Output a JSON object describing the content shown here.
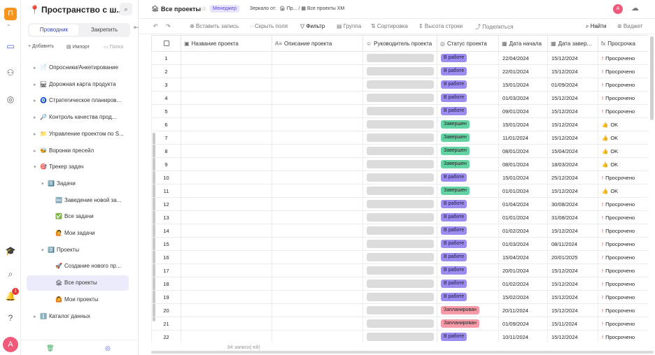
{
  "rail": {
    "workspace_letter": "П",
    "avatar_letter": "А",
    "notif_count": "1"
  },
  "sidebar": {
    "title": "Пространство с ш...",
    "tab_explorer": "Проводник",
    "tab_pinned": "Закрепить",
    "action_add": "+ Добавить",
    "action_import": "Импорт",
    "action_folder": "Папка",
    "items": [
      {
        "label": "Опросники/Анкетирование",
        "icon": "📄",
        "arrow": "▸"
      },
      {
        "label": "Дорожная карта продукта",
        "icon": "🛤",
        "arrow": "▸"
      },
      {
        "label": "Стратегическое планиров...",
        "icon": "🧿",
        "arrow": "▸"
      },
      {
        "label": "Контроль качества прод...",
        "icon": "🔎",
        "arrow": "▸"
      },
      {
        "label": "Управление проектом по S...",
        "icon": "📁",
        "arrow": "▸"
      },
      {
        "label": "Воронки пресейл",
        "icon": "🐝",
        "arrow": "▸"
      },
      {
        "label": "Трекер задач",
        "icon": "🎯",
        "arrow": "▾"
      },
      {
        "label": "Задачи",
        "icon": "1️⃣",
        "arrow": "▾"
      },
      {
        "label": "Заведение новой за...",
        "icon": "🆕",
        "arrow": ""
      },
      {
        "label": "Все задачи",
        "icon": "✅",
        "arrow": ""
      },
      {
        "label": "Мои задачи",
        "icon": "🙋",
        "arrow": ""
      },
      {
        "label": "Проекты",
        "icon": "2️⃣",
        "arrow": "▾"
      },
      {
        "label": "Создание нового пр...",
        "icon": "🚀",
        "arrow": ""
      },
      {
        "label": "Все проекты",
        "icon": "🏚",
        "arrow": ""
      },
      {
        "label": "Мои проекты",
        "icon": "🙆",
        "arrow": ""
      },
      {
        "label": "Каталог данных",
        "icon": "ℹ️",
        "arrow": "▸"
      }
    ]
  },
  "header": {
    "title": "Все проекты",
    "role_badge": "Менеджер",
    "mirror_prefix": "Зеркало от:",
    "mirror_path": "🏚 Пр...  /  ▦ Все проекты ХМ",
    "avatar_letter": "А"
  },
  "toolbar": {
    "insert": "⊕ Вставить запись",
    "hide": "◌ Скрыть поля",
    "filter": "▽ Фильтр",
    "group": "▤ Группа",
    "sort": "⇅ Сортировка",
    "row_height": "⇕ Высота строки",
    "share": "⤴ Поделиться",
    "find": "⌕ Найти",
    "widget": "⊛ Виджет"
  },
  "table": {
    "columns": [
      "Название проекта",
      "Описание проекта",
      "Руководитель проекта",
      "Статус проекта",
      "Дата начала",
      "Дата завер...",
      "Просрочка"
    ],
    "column_icons": [
      "▣",
      "A≡",
      "☺",
      "◎",
      "▦",
      "▦",
      "fx"
    ],
    "rows": [
      {
        "n": "1",
        "status": "В работе",
        "start": "22/04/2024",
        "end": "15/12/2024",
        "overdue": "Просрочено"
      },
      {
        "n": "2",
        "status": "В работе",
        "start": "22/01/2024",
        "end": "15/12/2024",
        "overdue": "Просрочено"
      },
      {
        "n": "3",
        "status": "В работе",
        "start": "15/01/2024",
        "end": "01/09/2024",
        "overdue": "Просрочено"
      },
      {
        "n": "4",
        "status": "В работе",
        "start": "01/03/2024",
        "end": "15/12/2024",
        "overdue": "Просрочено"
      },
      {
        "n": "5",
        "status": "В работе",
        "start": "09/01/2024",
        "end": "15/12/2024",
        "overdue": "Просрочено"
      },
      {
        "n": "6",
        "status": "Завершен",
        "start": "15/01/2024",
        "end": "15/12/2024",
        "overdue": "OK"
      },
      {
        "n": "7",
        "status": "Завершен",
        "start": "11/01/2024",
        "end": "15/12/2024",
        "overdue": "OK"
      },
      {
        "n": "8",
        "status": "Завершен",
        "start": "08/01/2024",
        "end": "15/04/2024",
        "overdue": "OK"
      },
      {
        "n": "9",
        "status": "Завершен",
        "start": "08/01/2024",
        "end": "18/03/2024",
        "overdue": "OK"
      },
      {
        "n": "10",
        "status": "В работе",
        "start": "15/01/2024",
        "end": "25/12/2024",
        "overdue": "Просрочено"
      },
      {
        "n": "11",
        "status": "Завершен",
        "start": "01/01/2024",
        "end": "15/12/2024",
        "overdue": "OK"
      },
      {
        "n": "12",
        "status": "В работе",
        "start": "01/04/2024",
        "end": "30/08/2024",
        "overdue": "Просрочено"
      },
      {
        "n": "13",
        "status": "В работе",
        "start": "01/01/2024",
        "end": "31/08/2024",
        "overdue": "Просрочено"
      },
      {
        "n": "14",
        "status": "В работе",
        "start": "01/02/2024",
        "end": "15/12/2024",
        "overdue": "Просрочено"
      },
      {
        "n": "15",
        "status": "В работе",
        "start": "01/03/2024",
        "end": "08/11/2024",
        "overdue": "Просрочено"
      },
      {
        "n": "16",
        "status": "В работе",
        "start": "15/04/2024",
        "end": "20/01/2025",
        "overdue": "Просрочено"
      },
      {
        "n": "17",
        "status": "В работе",
        "start": "20/01/2024",
        "end": "15/12/2024",
        "overdue": "Просрочено"
      },
      {
        "n": "18",
        "status": "В работе",
        "start": "01/02/2024",
        "end": "15/12/2024",
        "overdue": "Просрочено"
      },
      {
        "n": "19",
        "status": "В работе",
        "start": "15/02/2024",
        "end": "15/12/2024",
        "overdue": "Просрочено"
      },
      {
        "n": "20",
        "status": "Запланирован",
        "start": "20/11/2024",
        "end": "15/12/2024",
        "overdue": "Просрочено"
      },
      {
        "n": "21",
        "status": "Запланирован",
        "start": "01/09/2024",
        "end": "15/11/2024",
        "overdue": "Просрочено"
      },
      {
        "n": "22",
        "status": "В работе",
        "start": "10/11/2024",
        "end": "15/12/2024",
        "overdue": "Просрочено"
      }
    ]
  },
  "status_colors": {
    "В работе": "#9b8cf0",
    "Завершен": "#63d3a4",
    "Запланирован": "#f59aa6"
  },
  "footer": {
    "records": "84 записи(-ей)"
  }
}
